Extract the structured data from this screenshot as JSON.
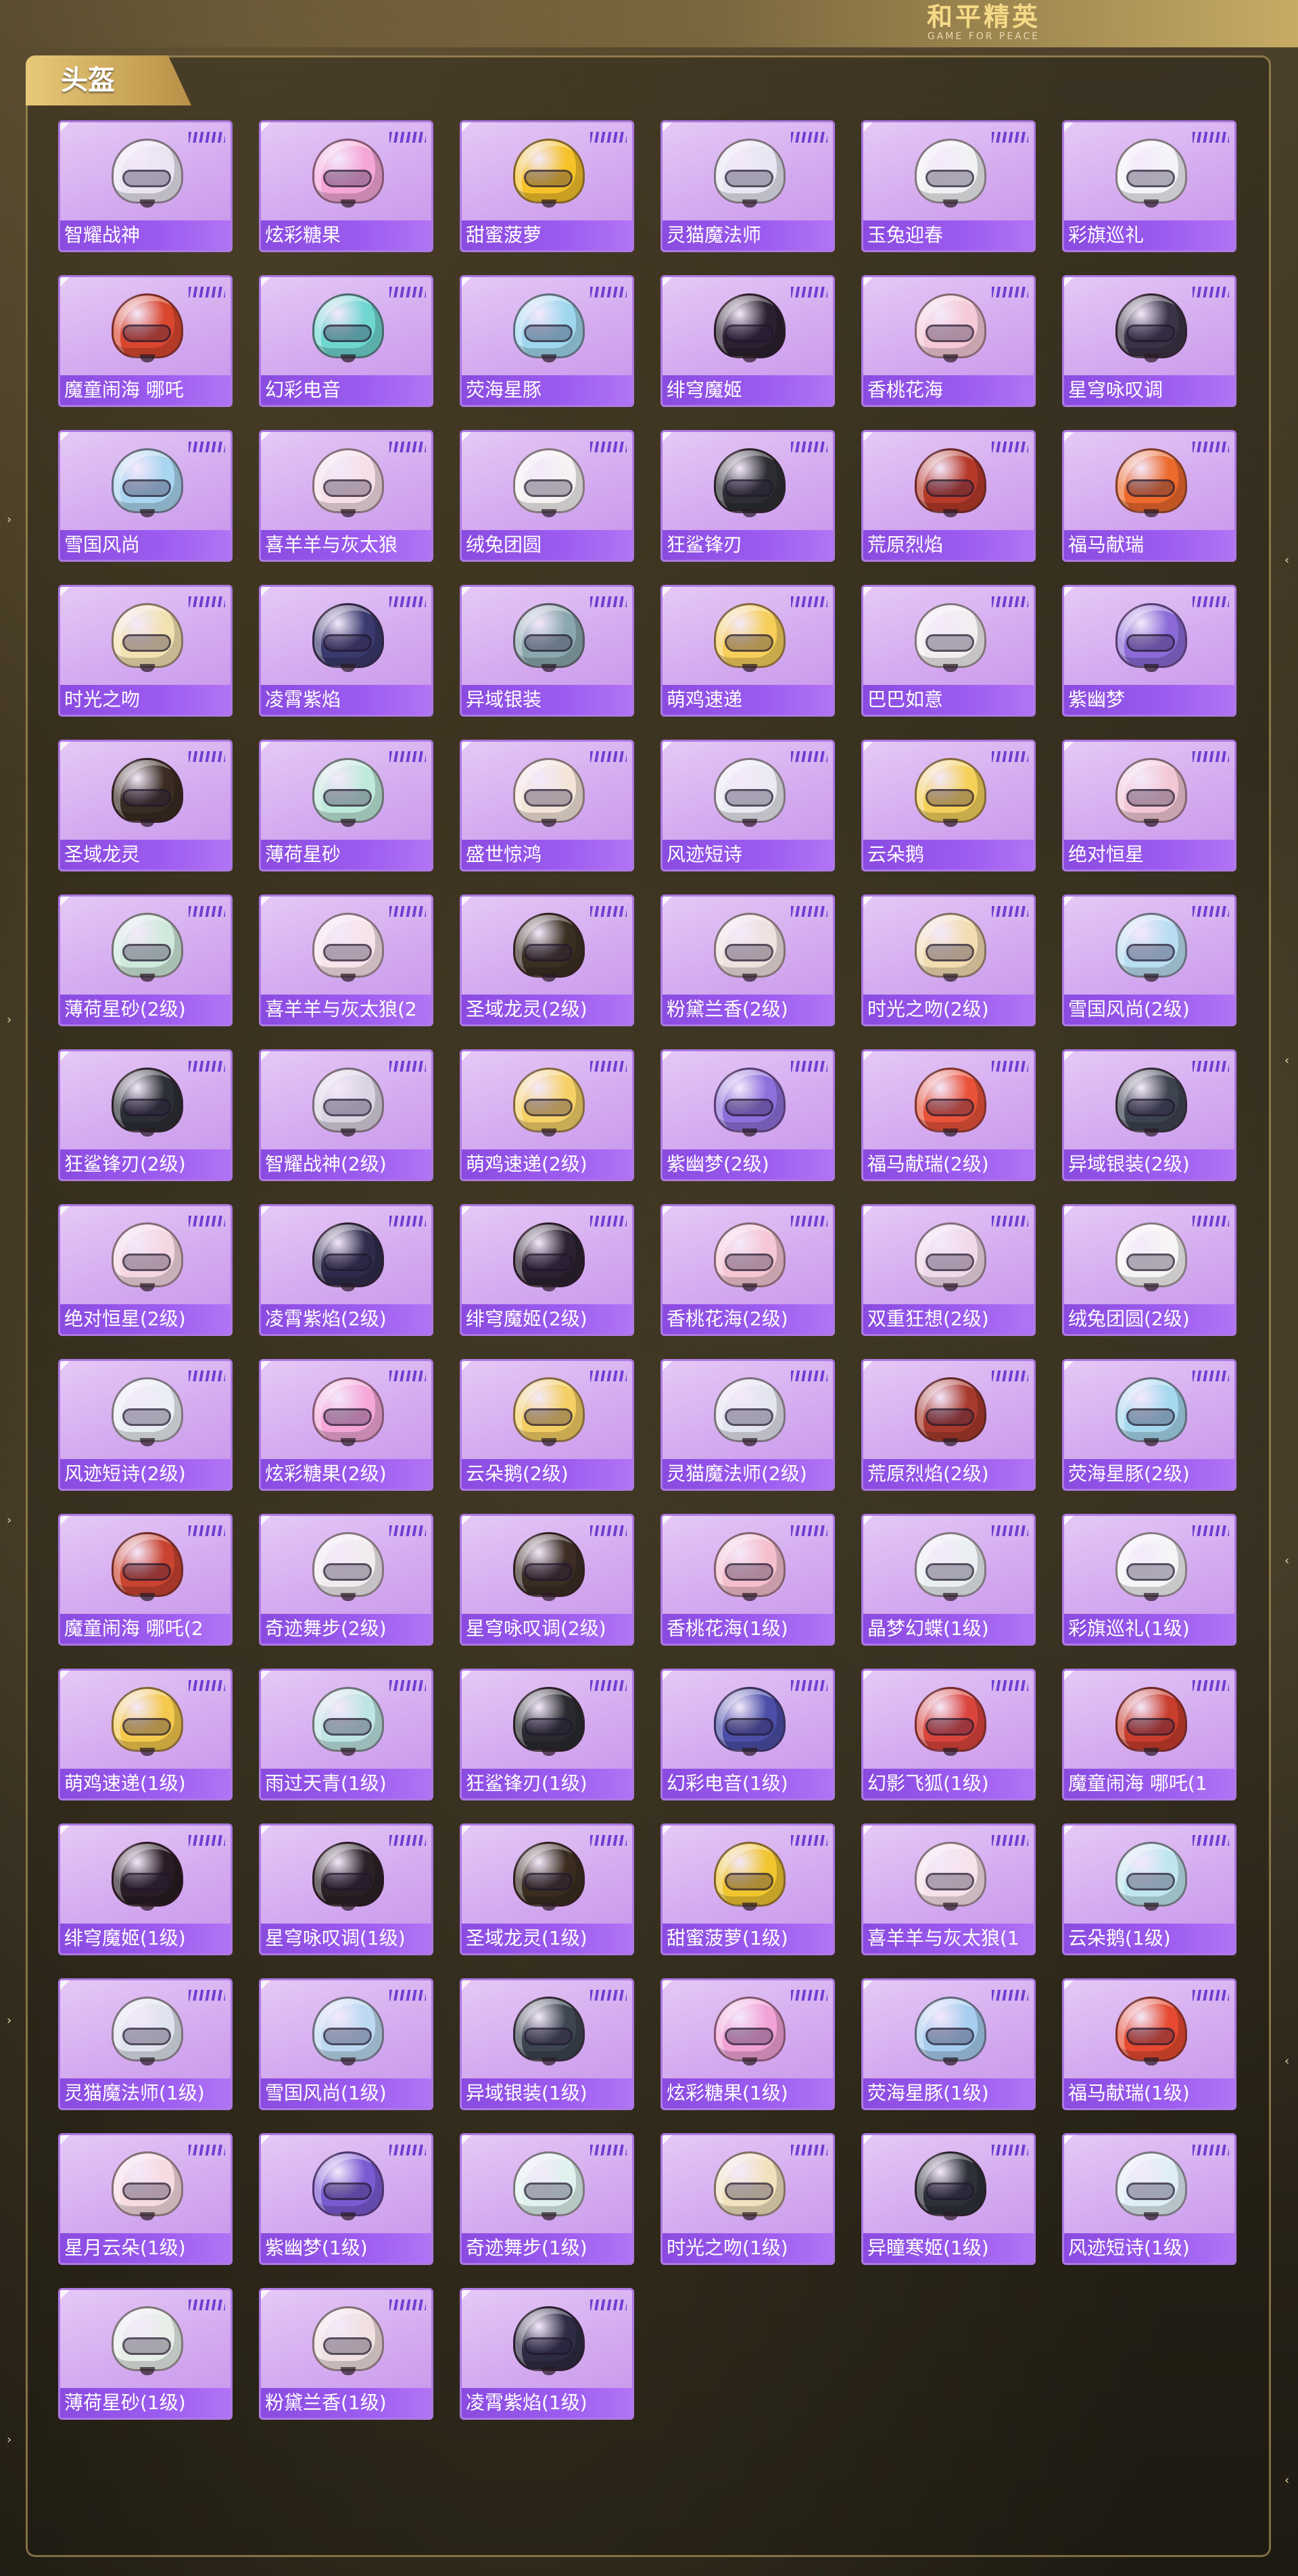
{
  "logo": {
    "title": "和平精英",
    "subtitle": "GAME FOR PEACE"
  },
  "section": {
    "title": "头盔"
  },
  "colors": {
    "card_bg": "#d3a9ef",
    "card_border": "#ad79e3",
    "label_bg": "#8a4be0",
    "accent_gold": "#e8c979"
  },
  "items": [
    {
      "name": "智耀战神",
      "color": "#e9e4f1"
    },
    {
      "name": "炫彩糖果",
      "color": "#f4a6d7"
    },
    {
      "name": "甜蜜菠萝",
      "color": "#f5c22a"
    },
    {
      "name": "灵猫魔法师",
      "color": "#e6e7f2"
    },
    {
      "name": "玉兔迎春",
      "color": "#f1f1f4"
    },
    {
      "name": "彩旗巡礼",
      "color": "#f4f4f8"
    },
    {
      "name": "魔童闹海 哪吒",
      "color": "#d9472f"
    },
    {
      "name": "幻彩电音",
      "color": "#6fd6d0"
    },
    {
      "name": "荧海星豚",
      "color": "#9fd7ee"
    },
    {
      "name": "绯穹魔姬",
      "color": "#2a2030"
    },
    {
      "name": "香桃花海",
      "color": "#f5c9d6"
    },
    {
      "name": "星穹咏叹调",
      "color": "#3a3346"
    },
    {
      "name": "雪国风尚",
      "color": "#a9d5f0"
    },
    {
      "name": "喜羊羊与灰太狼",
      "color": "#f6dfe6"
    },
    {
      "name": "绒兔团圆",
      "color": "#f5f2f1"
    },
    {
      "name": "狂鲨锋刃",
      "color": "#2d2e33"
    },
    {
      "name": "荒原烈焰",
      "color": "#b63a2a"
    },
    {
      "name": "福马献瑞",
      "color": "#ec6a2c"
    },
    {
      "name": "时光之吻",
      "color": "#f2e2b1"
    },
    {
      "name": "凌霄紫焰",
      "color": "#3b3a6e"
    },
    {
      "name": "异域银装",
      "color": "#8aa7ae"
    },
    {
      "name": "萌鸡速递",
      "color": "#f6cf5a"
    },
    {
      "name": "巴巴如意",
      "color": "#f2eef0"
    },
    {
      "name": "紫幽梦",
      "color": "#8b6ad7"
    },
    {
      "name": "圣域龙灵",
      "color": "#3a2c22"
    },
    {
      "name": "薄荷星砂",
      "color": "#bfe9db"
    },
    {
      "name": "盛世惊鸿",
      "color": "#f4e5d9"
    },
    {
      "name": "风迹短诗",
      "color": "#eaeaf2"
    },
    {
      "name": "云朵鹅",
      "color": "#f5d15b"
    },
    {
      "name": "绝对恒星",
      "color": "#f3c8d6"
    },
    {
      "name": "薄荷星砂(2级)",
      "color": "#cfe9dc"
    },
    {
      "name": "喜羊羊与灰太狼(2",
      "color": "#f7e3ea"
    },
    {
      "name": "圣域龙灵(2级)",
      "color": "#3b2f22"
    },
    {
      "name": "粉黛兰香(2级)",
      "color": "#efe1de"
    },
    {
      "name": "时光之吻(2级)",
      "color": "#f2ddb0"
    },
    {
      "name": "雪国风尚(2级)",
      "color": "#b9ddf1"
    },
    {
      "name": "狂鲨锋刃(2级)",
      "color": "#2d2f36"
    },
    {
      "name": "智耀战神(2级)",
      "color": "#d9d3e2"
    },
    {
      "name": "萌鸡速递(2级)",
      "color": "#f6d168"
    },
    {
      "name": "紫幽梦(2级)",
      "color": "#8e6fdb"
    },
    {
      "name": "福马献瑞(2级)",
      "color": "#e8533a"
    },
    {
      "name": "异域银装(2级)",
      "color": "#3d4450"
    },
    {
      "name": "绝对恒星(2级)",
      "color": "#f5d7e2"
    },
    {
      "name": "凌霄紫焰(2级)",
      "color": "#2f2c4b"
    },
    {
      "name": "绯穹魔姬(2级)",
      "color": "#2b2130"
    },
    {
      "name": "香桃花海(2级)",
      "color": "#f5c6d3"
    },
    {
      "name": "双重狂想(2级)",
      "color": "#f0d9e9"
    },
    {
      "name": "绒兔团圆(2级)",
      "color": "#f7f5f4"
    },
    {
      "name": "风迹短诗(2级)",
      "color": "#e9eef5"
    },
    {
      "name": "炫彩糖果(2级)",
      "color": "#f5a8d8"
    },
    {
      "name": "云朵鹅(2级)",
      "color": "#f4cf63"
    },
    {
      "name": "灵猫魔法师(2级)",
      "color": "#e3e5ef"
    },
    {
      "name": "荒原烈焰(2级)",
      "color": "#a83a2d"
    },
    {
      "name": "荧海星豚(2级)",
      "color": "#a6d9ef"
    },
    {
      "name": "魔童闹海 哪吒(2",
      "color": "#c94430"
    },
    {
      "name": "奇迹舞步(2级)",
      "color": "#f2ecef"
    },
    {
      "name": "星穹咏叹调(2级)",
      "color": "#3b2c24"
    },
    {
      "name": "香桃花海(1级)",
      "color": "#f5bfcd"
    },
    {
      "name": "晶梦幻蝶(1级)",
      "color": "#eaf0f2"
    },
    {
      "name": "彩旗巡礼(1级)",
      "color": "#f5f5f7"
    },
    {
      "name": "萌鸡速递(1级)",
      "color": "#f5c94d"
    },
    {
      "name": "雨过天青(1级)",
      "color": "#bfe4e4"
    },
    {
      "name": "狂鲨锋刃(1级)",
      "color": "#2a2b30"
    },
    {
      "name": "幻彩电音(1级)",
      "color": "#4b4fa8"
    },
    {
      "name": "幻影飞狐(1级)",
      "color": "#d9453c"
    },
    {
      "name": "魔童闹海 哪吒(1",
      "color": "#c93d2d"
    },
    {
      "name": "绯穹魔姬(1级)",
      "color": "#2a1c24"
    },
    {
      "name": "星穹咏叹调(1级)",
      "color": "#2a2026"
    },
    {
      "name": "圣域龙灵(1级)",
      "color": "#3a2c1f"
    },
    {
      "name": "甜蜜菠萝(1级)",
      "color": "#f0c530"
    },
    {
      "name": "喜羊羊与灰太狼(1",
      "color": "#f6e2ea"
    },
    {
      "name": "云朵鹅(1级)",
      "color": "#bfe6ef"
    },
    {
      "name": "灵猫魔法师(1级)",
      "color": "#dfe3ed"
    },
    {
      "name": "雪国风尚(1级)",
      "color": "#bcd9f1"
    },
    {
      "name": "异域银装(1级)",
      "color": "#3c4550"
    },
    {
      "name": "炫彩糖果(1级)",
      "color": "#f2a3d6"
    },
    {
      "name": "荧海星豚(1级)",
      "color": "#a7cdef"
    },
    {
      "name": "福马献瑞(1级)",
      "color": "#e64a30"
    },
    {
      "name": "星月云朵(1级)",
      "color": "#f6dbe0"
    },
    {
      "name": "紫幽梦(1级)",
      "color": "#7b5bd2"
    },
    {
      "name": "奇迹舞步(1级)",
      "color": "#dff2ee"
    },
    {
      "name": "时光之吻(1级)",
      "color": "#f1e2bd"
    },
    {
      "name": "异瞳寒姬(1级)",
      "color": "#2d3038"
    },
    {
      "name": "风迹短诗(1级)",
      "color": "#dfeef6"
    },
    {
      "name": "薄荷星砂(1级)",
      "color": "#e8efe9"
    },
    {
      "name": "粉黛兰香(1级)",
      "color": "#f0e0df"
    },
    {
      "name": "凌霄紫焰(1级)",
      "color": "#2e2c44"
    }
  ]
}
